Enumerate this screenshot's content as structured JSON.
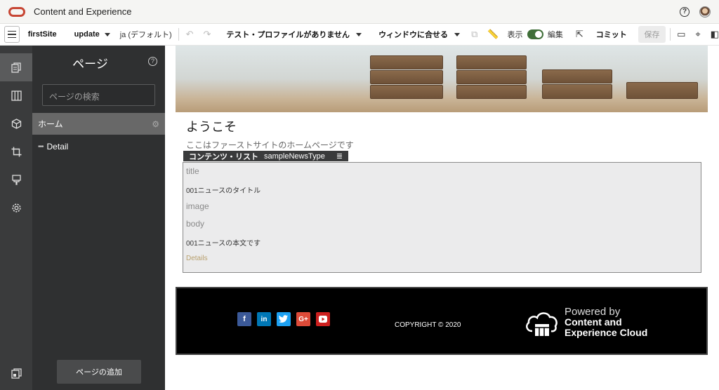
{
  "app": {
    "title": "Content and Experience"
  },
  "toolbar": {
    "site_name": "firstSite",
    "update_label": "update",
    "language_label": "ja (デフォルト)",
    "test_profile_label": "テスト・プロファイルがありません",
    "fit_window_label": "ウィンドウに合せる",
    "view_label": "表示",
    "edit_label": "編集",
    "commit_label": "コミット",
    "save_label": "保存"
  },
  "pages_panel": {
    "title": "ページ",
    "search_placeholder": "ページの検索",
    "pages": [
      {
        "label": "ホーム"
      },
      {
        "label": "Detail"
      }
    ],
    "add_page_label": "ページの追加"
  },
  "canvas": {
    "welcome": "ようこそ",
    "subline": "ここはファーストサイトのホームページです",
    "content_list": {
      "label": "コンテンツ・リスト",
      "type_name": "sampleNewsType",
      "fields": [
        {
          "name": "title",
          "value": "001ニュースのタイトル"
        },
        {
          "name": "image",
          "value": ""
        },
        {
          "name": "body",
          "value": "001ニュースの本文です"
        }
      ],
      "details_link": "Details"
    },
    "footer": {
      "copyright": "COPYRIGHT © 2020",
      "powered_line1": "Powered by",
      "powered_line2": "Content and",
      "powered_line3": "Experience Cloud",
      "social_icons": [
        "facebook-icon",
        "linkedin-icon",
        "twitter-icon",
        "google-plus-icon",
        "youtube-icon"
      ]
    }
  },
  "colors": {
    "oracle_red": "#c74634",
    "toggle_green": "#3f6e38",
    "facebook": "#3b5998",
    "linkedin": "#0077b5",
    "twitter": "#1da1f2",
    "google_plus": "#dd4b39",
    "youtube": "#cd201f",
    "details_link": "#b8a06e"
  }
}
